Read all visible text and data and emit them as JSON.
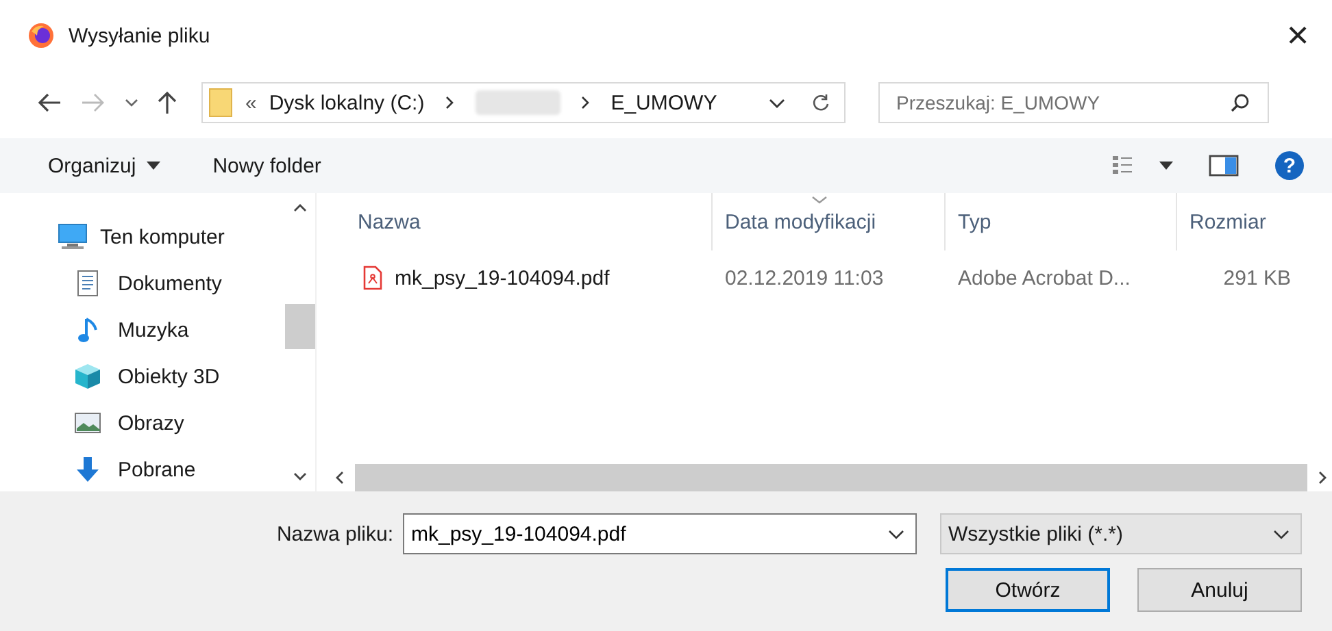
{
  "window": {
    "title": "Wysyłanie pliku",
    "close": "×"
  },
  "address": {
    "overflow": "«",
    "segments": [
      {
        "kind": "text",
        "label": "Dysk lokalny (C:)"
      },
      {
        "kind": "blurred"
      },
      {
        "kind": "text",
        "label": "E_UMOWY"
      }
    ]
  },
  "search": {
    "placeholder": "Przeszukaj: E_UMOWY"
  },
  "toolbar": {
    "organize": "Organizuj",
    "new_folder": "Nowy folder",
    "help": "?"
  },
  "sidebar": {
    "items": [
      {
        "label": "Ten komputer",
        "kind": "computer",
        "children": [
          {
            "label": "Dokumenty",
            "kind": "documents"
          },
          {
            "label": "Muzyka",
            "kind": "music"
          },
          {
            "label": "Obiekty 3D",
            "kind": "objects3d"
          },
          {
            "label": "Obrazy",
            "kind": "pictures"
          },
          {
            "label": "Pobrane",
            "kind": "downloads"
          }
        ]
      }
    ]
  },
  "table": {
    "columns": [
      {
        "label": "Nazwa",
        "sorted": false
      },
      {
        "label": "Data modyfikacji",
        "sorted": true
      },
      {
        "label": "Typ",
        "sorted": false
      },
      {
        "label": "Rozmiar",
        "sorted": false
      }
    ],
    "rows": [
      {
        "name": "mk_psy_19-104094.pdf",
        "modified": "02.12.2019 11:03",
        "type": "Adobe Acrobat D...",
        "size": "291 KB"
      }
    ]
  },
  "footer": {
    "filename_label": "Nazwa pliku:",
    "filename": "mk_psy_19-104094.pdf",
    "filter": "Wszystkie pliki (*.*)",
    "buttons": [
      {
        "label": "Otwórz",
        "default": true
      },
      {
        "label": "Anuluj",
        "default": false
      }
    ]
  }
}
